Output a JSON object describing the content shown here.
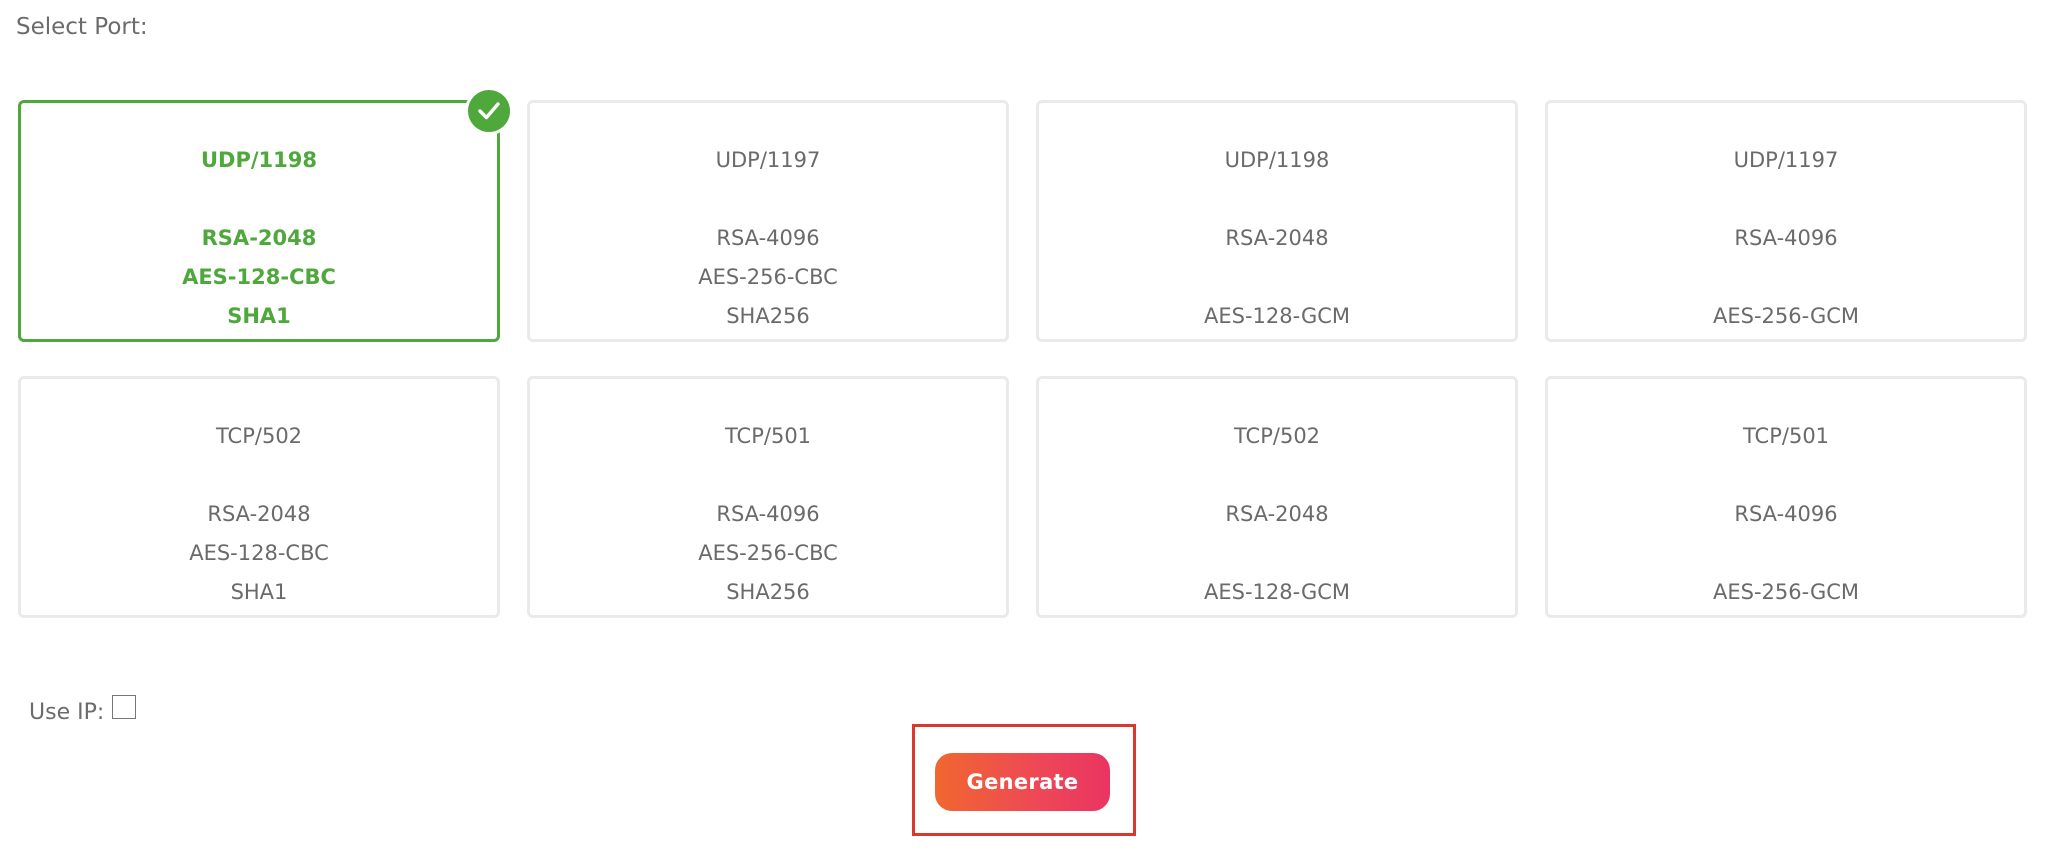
{
  "header": {
    "select_port_label": "Select Port:"
  },
  "ports": [
    {
      "protocol": "UDP/1198",
      "key": "RSA-2048",
      "cipher": "AES-128-CBC",
      "auth": "SHA1",
      "selected": true
    },
    {
      "protocol": "UDP/1197",
      "key": "RSA-4096",
      "cipher": "AES-256-CBC",
      "auth": "SHA256",
      "selected": false
    },
    {
      "protocol": "UDP/1198",
      "key": "RSA-2048",
      "cipher": "",
      "auth": "AES-128-GCM",
      "selected": false
    },
    {
      "protocol": "UDP/1197",
      "key": "RSA-4096",
      "cipher": "",
      "auth": "AES-256-GCM",
      "selected": false
    },
    {
      "protocol": "TCP/502",
      "key": "RSA-2048",
      "cipher": "AES-128-CBC",
      "auth": "SHA1",
      "selected": false
    },
    {
      "protocol": "TCP/501",
      "key": "RSA-4096",
      "cipher": "AES-256-CBC",
      "auth": "SHA256",
      "selected": false
    },
    {
      "protocol": "TCP/502",
      "key": "RSA-2048",
      "cipher": "",
      "auth": "AES-128-GCM",
      "selected": false
    },
    {
      "protocol": "TCP/501",
      "key": "RSA-4096",
      "cipher": "",
      "auth": "AES-256-GCM",
      "selected": false
    }
  ],
  "options": {
    "use_ip_label": "Use IP:",
    "use_ip_checked": false
  },
  "actions": {
    "generate_label": "Generate"
  },
  "icons": {
    "selected_indicator": "check-icon"
  },
  "colors": {
    "accent_green": "#4ea83b",
    "button_gradient_start": "#f0672f",
    "button_gradient_end": "#ea3461",
    "highlight_red": "#d9382c"
  }
}
